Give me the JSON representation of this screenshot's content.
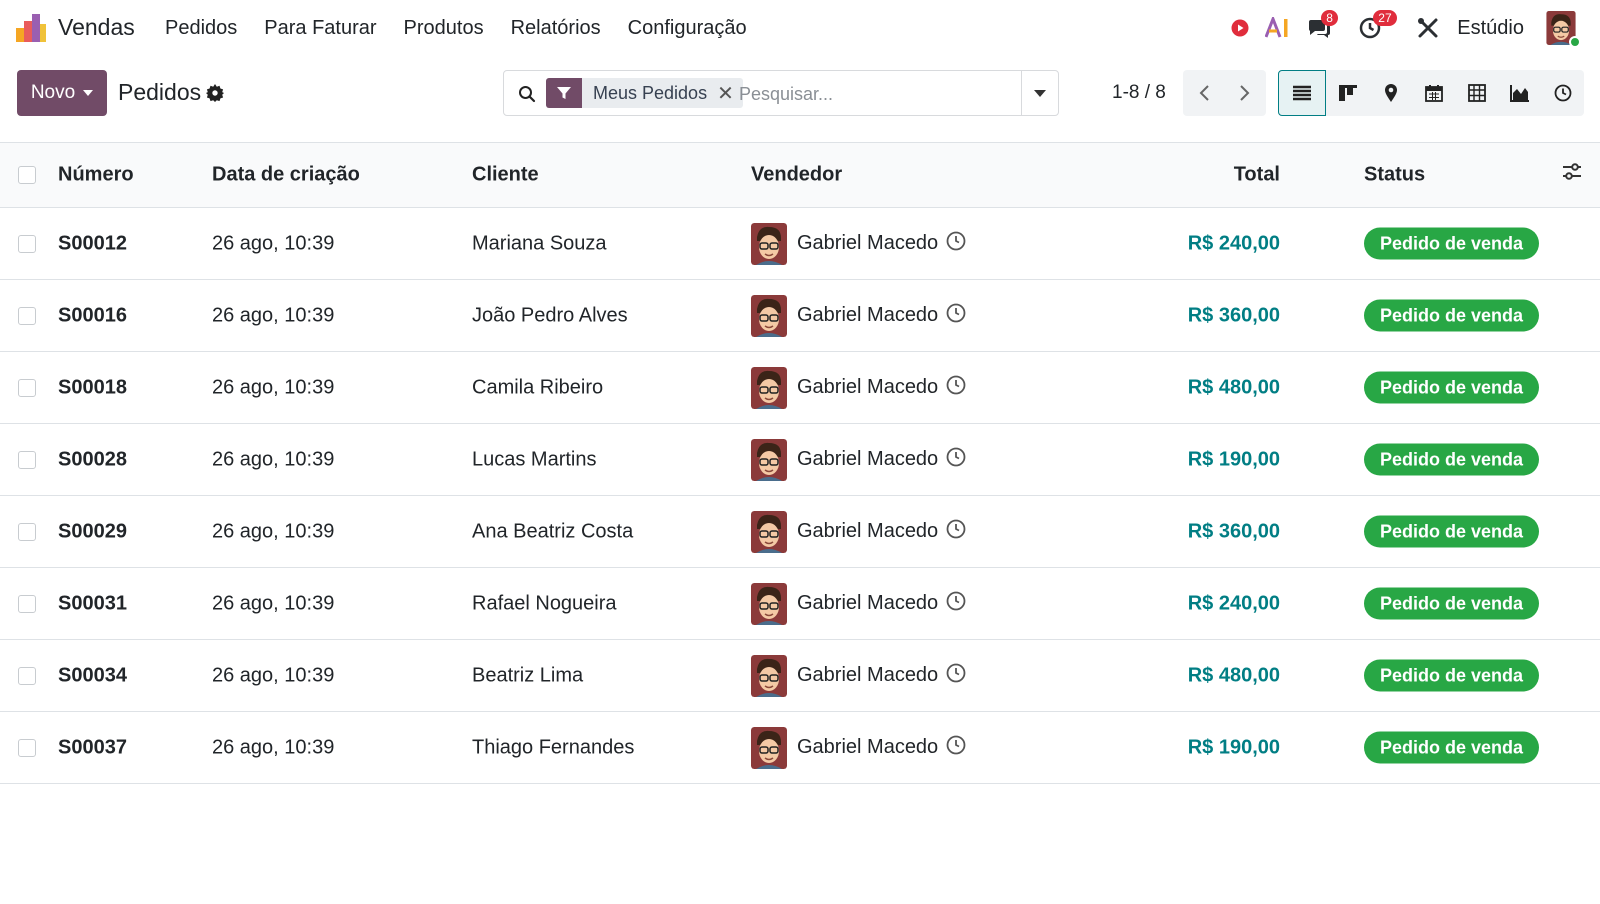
{
  "navbar": {
    "app_name": "Vendas",
    "menu": [
      "Pedidos",
      "Para Faturar",
      "Produtos",
      "Relatórios",
      "Configuração"
    ],
    "messages_badge": "8",
    "activities_badge": "27",
    "studio_label": "Estúdio"
  },
  "control_panel": {
    "new_label": "Novo",
    "title": "Pedidos",
    "search": {
      "facet_label": "Meus Pedidos",
      "facet_close": "✕",
      "placeholder": "Pesquisar..."
    },
    "pager": "1-8 / 8"
  },
  "list": {
    "columns": [
      "Número",
      "Data de criação",
      "Cliente",
      "Vendedor",
      "Total",
      "Status"
    ],
    "rows": [
      {
        "number": "S00012",
        "date": "26 ago, 10:39",
        "client": "Mariana Souza",
        "salesperson": "Gabriel Macedo",
        "total": "R$ 240,00",
        "status": "Pedido de venda"
      },
      {
        "number": "S00016",
        "date": "26 ago, 10:39",
        "client": "João Pedro Alves",
        "salesperson": "Gabriel Macedo",
        "total": "R$ 360,00",
        "status": "Pedido de venda"
      },
      {
        "number": "S00018",
        "date": "26 ago, 10:39",
        "client": "Camila Ribeiro",
        "salesperson": "Gabriel Macedo",
        "total": "R$ 480,00",
        "status": "Pedido de venda"
      },
      {
        "number": "S00028",
        "date": "26 ago, 10:39",
        "client": "Lucas Martins",
        "salesperson": "Gabriel Macedo",
        "total": "R$ 190,00",
        "status": "Pedido de venda"
      },
      {
        "number": "S00029",
        "date": "26 ago, 10:39",
        "client": "Ana Beatriz Costa",
        "salesperson": "Gabriel Macedo",
        "total": "R$ 360,00",
        "status": "Pedido de venda"
      },
      {
        "number": "S00031",
        "date": "26 ago, 10:39",
        "client": "Rafael Nogueira",
        "salesperson": "Gabriel Macedo",
        "total": "R$ 240,00",
        "status": "Pedido de venda"
      },
      {
        "number": "S00034",
        "date": "26 ago, 10:39",
        "client": "Beatriz Lima",
        "salesperson": "Gabriel Macedo",
        "total": "R$ 480,00",
        "status": "Pedido de venda"
      },
      {
        "number": "S00037",
        "date": "26 ago, 10:39",
        "client": "Thiago Fernandes",
        "salesperson": "Gabriel Macedo",
        "total": "R$ 190,00",
        "status": "Pedido de venda"
      }
    ]
  },
  "colors": {
    "brand": "#714b67",
    "accent": "#017e84",
    "status_success": "#28a745",
    "badge": "#e02d3c"
  },
  "icons": [
    "app-logo-icon",
    "record-icon",
    "ai-icon",
    "messages-icon",
    "activities-icon",
    "studio-tools-icon",
    "gear-icon",
    "search-icon",
    "filter-icon",
    "chevron-left-icon",
    "chevron-right-icon",
    "list-view-icon",
    "kanban-view-icon",
    "map-view-icon",
    "calendar-view-icon",
    "pivot-view-icon",
    "graph-view-icon",
    "activity-view-icon",
    "clock-icon",
    "optional-columns-icon"
  ]
}
